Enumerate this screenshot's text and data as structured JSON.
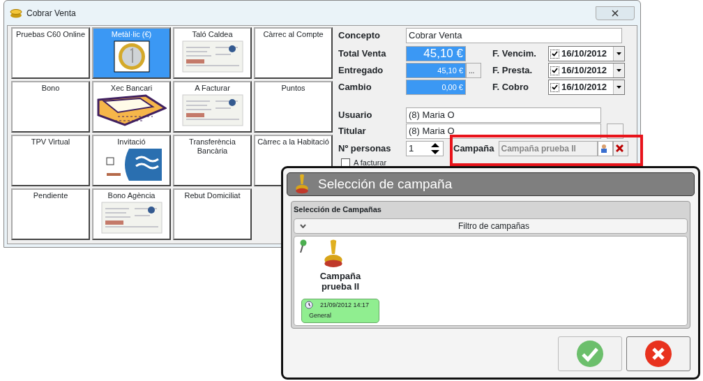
{
  "window": {
    "title": "Cobrar Venta"
  },
  "payment_methods": [
    {
      "label": "Pruebas C60 Online",
      "kind": "plain",
      "selected": false
    },
    {
      "label": "Metàl·lic (€)",
      "kind": "coin",
      "selected": true
    },
    {
      "label": "Taló Caldea",
      "kind": "document",
      "selected": false
    },
    {
      "label": "Càrrec al Compte",
      "kind": "plain",
      "selected": false
    },
    {
      "label": "Bono",
      "kind": "plain",
      "selected": false
    },
    {
      "label": "Xec Bancari",
      "kind": "chequebook",
      "selected": false
    },
    {
      "label": "A Facturar",
      "kind": "document",
      "selected": false
    },
    {
      "label": "Puntos",
      "kind": "plain",
      "selected": false
    },
    {
      "label": "TPV Virtual",
      "kind": "plain",
      "selected": false
    },
    {
      "label": "Invitació",
      "kind": "card",
      "selected": false
    },
    {
      "label": "Transferència Bancària",
      "kind": "plain",
      "selected": false
    },
    {
      "label": "Càrrec a la Habitació",
      "kind": "plain",
      "selected": false
    },
    {
      "label": "Pendiente",
      "kind": "plain",
      "selected": false
    },
    {
      "label": "Bono Agència",
      "kind": "document",
      "selected": false
    },
    {
      "label": "Rebut Domiciliat",
      "kind": "plain",
      "selected": false
    }
  ],
  "concepto": {
    "label": "Concepto",
    "value": "Cobrar Venta"
  },
  "amounts": [
    {
      "label": "Total Venta",
      "value": "45,10 €",
      "kind": "big"
    },
    {
      "label": "Entregado",
      "value": "45,10 €",
      "kind": "button",
      "button": "..."
    },
    {
      "label": "Cambio",
      "value": "0,00 €",
      "kind": "small"
    }
  ],
  "dates": [
    {
      "label": "F. Vencim.",
      "value": "16/10/2012",
      "checked": true
    },
    {
      "label": "F. Presta.",
      "value": "16/10/2012",
      "checked": true
    },
    {
      "label": "F. Cobro",
      "value": "16/10/2012",
      "checked": true
    }
  ],
  "usuario": {
    "label": "Usuario",
    "value": "(8) Maria O"
  },
  "titular": {
    "label": "Titular",
    "value": "(8) Maria O"
  },
  "personas": {
    "label": "Nº personas",
    "value": "1"
  },
  "campana": {
    "label": "Campaña",
    "value": "Campaña prueba II"
  },
  "a_facturar": {
    "label": "A facturar",
    "checked": false
  },
  "dialog": {
    "title": "Selección de campaña",
    "group_title": "Selección de Campañas",
    "filter": "Filtro de campañas",
    "campaigns": [
      {
        "name": "Campaña prueba II",
        "date": "21/09/2012 14:17",
        "category": "General",
        "color": "#90ee90",
        "selected": false
      }
    ]
  }
}
